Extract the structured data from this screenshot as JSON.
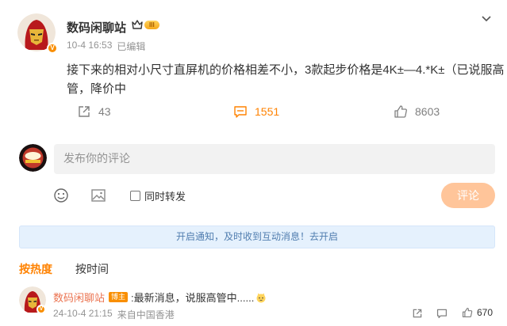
{
  "post": {
    "author": "数码闲聊站",
    "level_badge": "III",
    "time": "10-4 16:53",
    "edited": "已编辑",
    "text": "接下来的相对小尺寸直屏机的价格相差不小，3款起步价格是4K±—4.*K±（已说服高管，降价中",
    "repost_count": "43",
    "comment_count": "1551",
    "like_count": "8603"
  },
  "compose": {
    "placeholder": "发布你的评论",
    "also_repost": "同时转发",
    "submit": "评论"
  },
  "notice": {
    "text": "开启通知，及时收到互动消息！去开启"
  },
  "sort_tabs": [
    {
      "label": "按热度",
      "active": true
    },
    {
      "label": "按时间",
      "active": false
    }
  ],
  "comments": [
    {
      "author": "数码闲聊站",
      "tag": "博主",
      "text": ":最新消息，说服高管中......",
      "time": "24-10-4 21:15",
      "location": "来自中国香港",
      "like_count": "670"
    }
  ],
  "colors": {
    "accent": "#ff8200",
    "link": "#eb7350",
    "notice_bg": "#e5f1fd",
    "button_disabled": "#ffc59a"
  }
}
